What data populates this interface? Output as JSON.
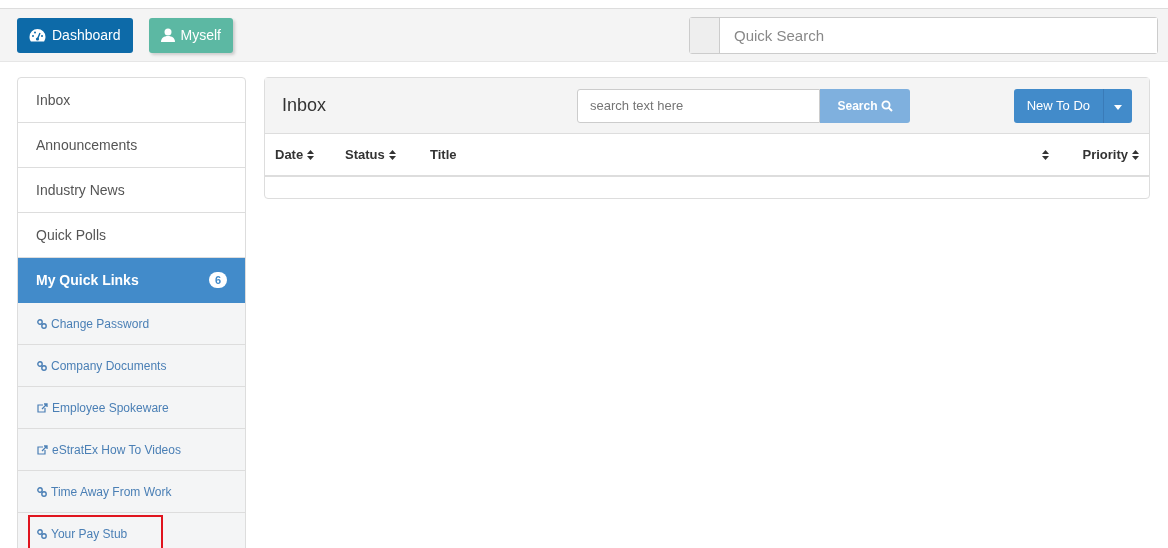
{
  "topbar": {
    "buttons": [
      {
        "label": "Dashboard",
        "kind": "dashboard"
      },
      {
        "label": "Myself",
        "kind": "user"
      }
    ],
    "search": {
      "placeholder": "Quick Search"
    }
  },
  "sidebar": {
    "items": [
      {
        "label": "Inbox",
        "selected": false
      },
      {
        "label": "Announcements",
        "selected": false
      },
      {
        "label": "Industry News",
        "selected": false
      },
      {
        "label": "Quick Polls",
        "selected": false
      },
      {
        "label": "My Quick Links",
        "selected": true,
        "badge": "6"
      }
    ],
    "links": [
      {
        "label": "Change Password",
        "kind": "link",
        "highlighted": false
      },
      {
        "label": "Company Documents",
        "kind": "link",
        "highlighted": false
      },
      {
        "label": "Employee Spokeware",
        "kind": "external",
        "highlighted": false
      },
      {
        "label": "eStratEx How To Videos",
        "kind": "external",
        "highlighted": false
      },
      {
        "label": "Time Away From Work",
        "kind": "link",
        "highlighted": false
      },
      {
        "label": "Your Pay Stub",
        "kind": "link",
        "highlighted": true
      }
    ]
  },
  "inbox": {
    "title": "Inbox",
    "search": {
      "placeholder": "search text here",
      "button": "Search"
    },
    "new_button": "New To Do",
    "columns": [
      {
        "label": "Date",
        "sortable": true
      },
      {
        "label": "Status",
        "sortable": true
      },
      {
        "label": "Title"
      },
      {
        "sortable": true
      },
      {
        "label": "Priority",
        "sortable": true
      }
    ]
  }
}
